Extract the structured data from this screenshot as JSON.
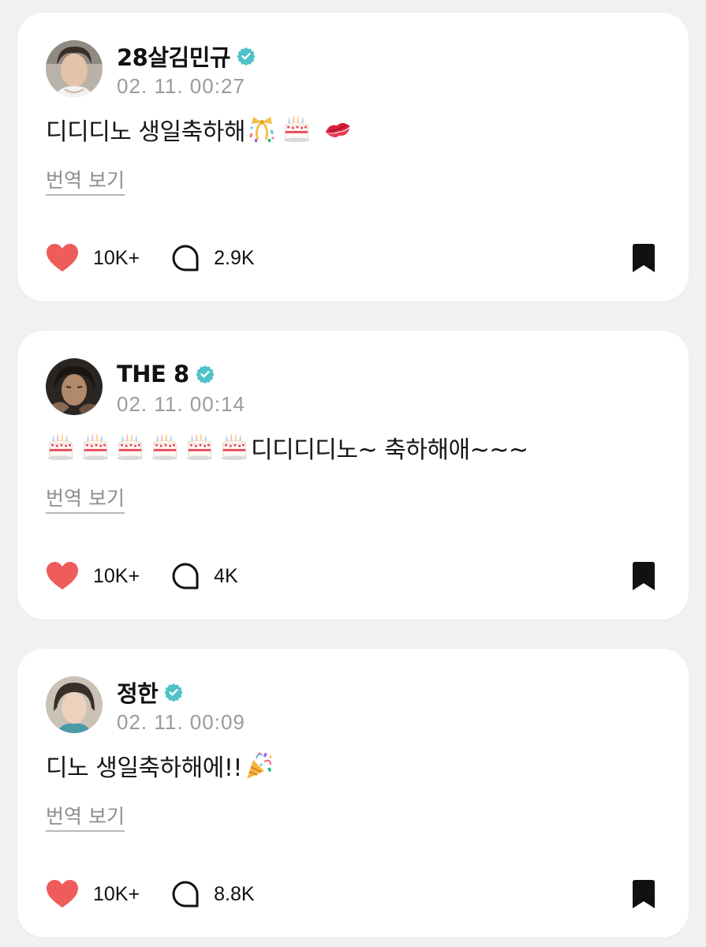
{
  "posts": [
    {
      "author": "28살김민규",
      "timestamp": "02. 11. 00:27",
      "text": "디디디노 생일축하해",
      "emojis": [
        "ribbon-confetti-icon",
        "birthday-cake-icon",
        "kiss-mark-icon"
      ],
      "translate_label": "번역 보기",
      "likes": "10K+",
      "comments": "2.9K"
    },
    {
      "author": "THE 8",
      "timestamp": "02. 11. 00:14",
      "text_prefix_emoji": "birthday-cake-icon",
      "text_prefix_emoji_count": 6,
      "text": "디디디디노~ 축하해애~~~",
      "translate_label": "번역 보기",
      "likes": "10K+",
      "comments": "4K"
    },
    {
      "author": "정한",
      "timestamp": "02. 11. 00:09",
      "text": "디노 생일축하해에!!",
      "emojis": [
        "party-popper-icon"
      ],
      "translate_label": "번역 보기",
      "likes": "10K+",
      "comments": "8.8K"
    }
  ],
  "colors": {
    "background": "#f1f1f3",
    "card": "#ffffff",
    "verified_badge": "#4fc3c7",
    "heart": "#ee5c5c",
    "timestamp": "#9a9a9f"
  }
}
